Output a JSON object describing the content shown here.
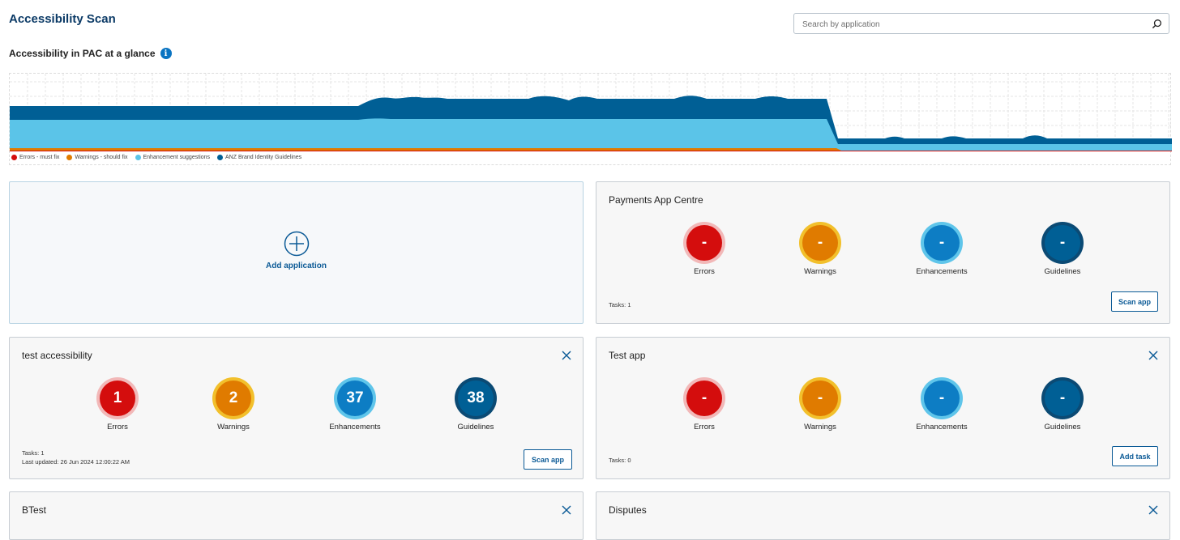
{
  "page": {
    "title": "Accessibility Scan"
  },
  "search": {
    "placeholder": "Search by application"
  },
  "glance": {
    "heading": "Accessibility in PAC at a glance"
  },
  "chart_data": {
    "type": "area",
    "title": "",
    "xlabel": "",
    "ylabel": "",
    "grid": true,
    "legend": "bottom-left",
    "stacked": true,
    "series": [
      {
        "name": "Errors - must fix",
        "color": "#d40d0d"
      },
      {
        "name": "Warnings - should fix",
        "color": "#e07b00"
      },
      {
        "name": "Enhancement suggestions",
        "color": "#5bc4e8"
      },
      {
        "name": "ANZ Brand Identity Guidelines",
        "color": "#005f95"
      }
    ]
  },
  "cards": {
    "add": {
      "label": "Add application"
    },
    "payments": {
      "title": "Payments App Centre",
      "values": [
        "-",
        "-",
        "-",
        "-"
      ],
      "tasks": "Tasks: 1",
      "button": "Scan app"
    },
    "test_accessibility": {
      "title": "test accessibility",
      "values": [
        "1",
        "2",
        "37",
        "38"
      ],
      "tasks": "Tasks: 1",
      "updated": "Last updated: 26 Jun 2024 12:00:22 AM",
      "button": "Scan app"
    },
    "test_app": {
      "title": "Test app",
      "values": [
        "-",
        "-",
        "-",
        "-"
      ],
      "tasks": "Tasks: 0",
      "button": "Add task"
    },
    "btest": {
      "title": "BTest"
    },
    "disputes": {
      "title": "Disputes"
    }
  },
  "metric_labels": {
    "errors": "Errors",
    "warnings": "Warnings",
    "enhancements": "Enhancements",
    "guidelines": "Guidelines"
  }
}
